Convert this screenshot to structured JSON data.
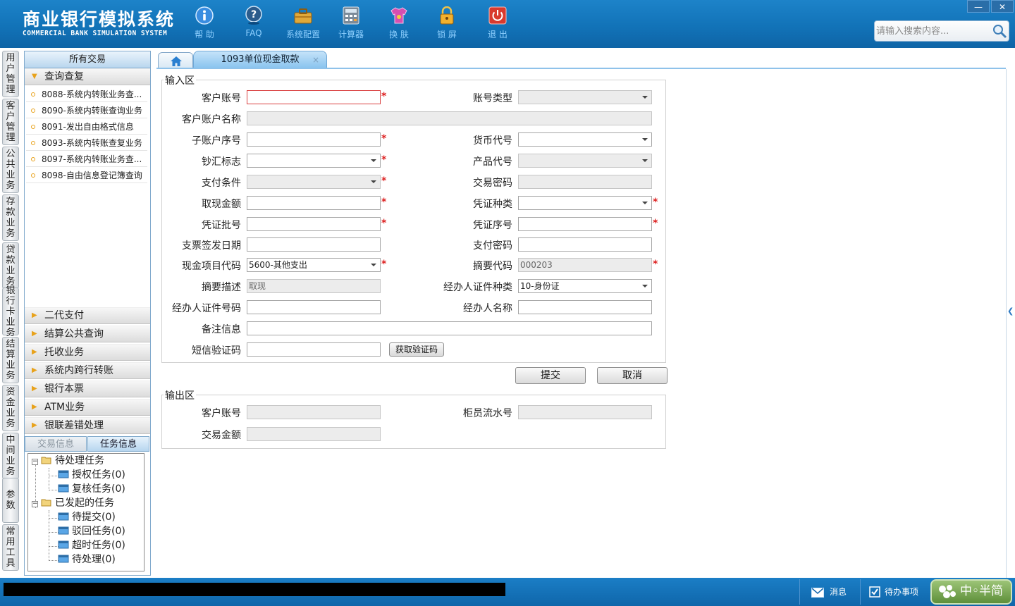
{
  "app": {
    "title": "商业银行模拟系统",
    "subtitle": "COMMERCIAL BANK SIMULATION SYSTEM"
  },
  "toolbar": [
    {
      "label": "帮 助",
      "icon": "info-icon"
    },
    {
      "label": "FAQ",
      "icon": "help-icon"
    },
    {
      "label": "系统配置",
      "icon": "toolbox-icon"
    },
    {
      "label": "计算器",
      "icon": "calculator-icon"
    },
    {
      "label": "换 肤",
      "icon": "shirt-icon"
    },
    {
      "label": "锁 屏",
      "icon": "lock-icon"
    },
    {
      "label": "退 出",
      "icon": "power-icon"
    }
  ],
  "search": {
    "placeholder": "请输入搜索内容..."
  },
  "window": {
    "minimize": "—",
    "close": "✕"
  },
  "vtabs": [
    "用户管理",
    "客户管理",
    "公共业务",
    "存款业务",
    "贷款业务",
    "银行卡业务",
    "结算业务",
    "资金业务",
    "中间业务",
    "参数",
    "常用工具"
  ],
  "menu": {
    "header": "所有交易",
    "open_category": "查询查复",
    "sub_items": [
      "8088-系统内转账业务查...",
      "8090-系统内转账查询业务",
      "8091-发出自由格式信息",
      "8093-系统内转账查复业务",
      "8097-系统内转账业务查...",
      "8098-自由信息登记簿查询"
    ],
    "categories": [
      "二代支付",
      "结算公共查询",
      "托收业务",
      "系统内跨行转账",
      "银行本票",
      "ATM业务",
      "银联差错处理"
    ]
  },
  "bottom_tabs": {
    "tx": "交易信息",
    "task": "任务信息"
  },
  "tree": {
    "pending": "待处理任务",
    "auth": "授权任务(0)",
    "review": "复核任务(0)",
    "initiated": "已发起的任务",
    "to_submit": "待提交(0)",
    "rejected": "驳回任务(0)",
    "timeout": "超时任务(0)",
    "to_process": "待处理(0)"
  },
  "tabs": {
    "active": "1093单位现金取款",
    "close": "×"
  },
  "input_section": {
    "legend": "输入区",
    "customer_account": {
      "label": "客户账号",
      "value": ""
    },
    "account_type": {
      "label": "账号类型",
      "value": ""
    },
    "customer_name": {
      "label": "客户账户名称",
      "value": ""
    },
    "sub_account_no": {
      "label": "子账户序号",
      "value": ""
    },
    "currency_code": {
      "label": "货币代号",
      "value": ""
    },
    "cash_flag": {
      "label": "钞汇标志",
      "value": ""
    },
    "product_code": {
      "label": "产品代号",
      "value": ""
    },
    "pay_condition": {
      "label": "支付条件",
      "value": ""
    },
    "tx_password": {
      "label": "交易密码",
      "value": ""
    },
    "withdraw_amount": {
      "label": "取现金额",
      "value": ""
    },
    "voucher_type": {
      "label": "凭证种类",
      "value": ""
    },
    "voucher_batch": {
      "label": "凭证批号",
      "value": ""
    },
    "voucher_no": {
      "label": "凭证序号",
      "value": ""
    },
    "check_date": {
      "label": "支票签发日期",
      "value": ""
    },
    "pay_password": {
      "label": "支付密码",
      "value": ""
    },
    "cash_item_code": {
      "label": "现金项目代码",
      "value": "5600-其他支出"
    },
    "summary_code": {
      "label": "摘要代码",
      "value": "000203"
    },
    "summary_desc": {
      "label": "摘要描述",
      "value": "取现"
    },
    "agent_id_type": {
      "label": "经办人证件种类",
      "value": "10-身份证"
    },
    "agent_id_no": {
      "label": "经办人证件号码",
      "value": ""
    },
    "agent_name": {
      "label": "经办人名称",
      "value": ""
    },
    "remark": {
      "label": "备注信息",
      "value": ""
    },
    "sms_code": {
      "label": "短信验证码",
      "value": "",
      "button": "获取验证码"
    }
  },
  "actions": {
    "submit": "提交",
    "cancel": "取消"
  },
  "output_section": {
    "legend": "输出区",
    "customer_account": {
      "label": "客户账号",
      "value": ""
    },
    "teller_serial": {
      "label": "柜员流水号",
      "value": ""
    },
    "tx_amount": {
      "label": "交易金额",
      "value": ""
    }
  },
  "status": {
    "message": "消息",
    "todo": "待办事项",
    "ime": "中◦半简"
  }
}
